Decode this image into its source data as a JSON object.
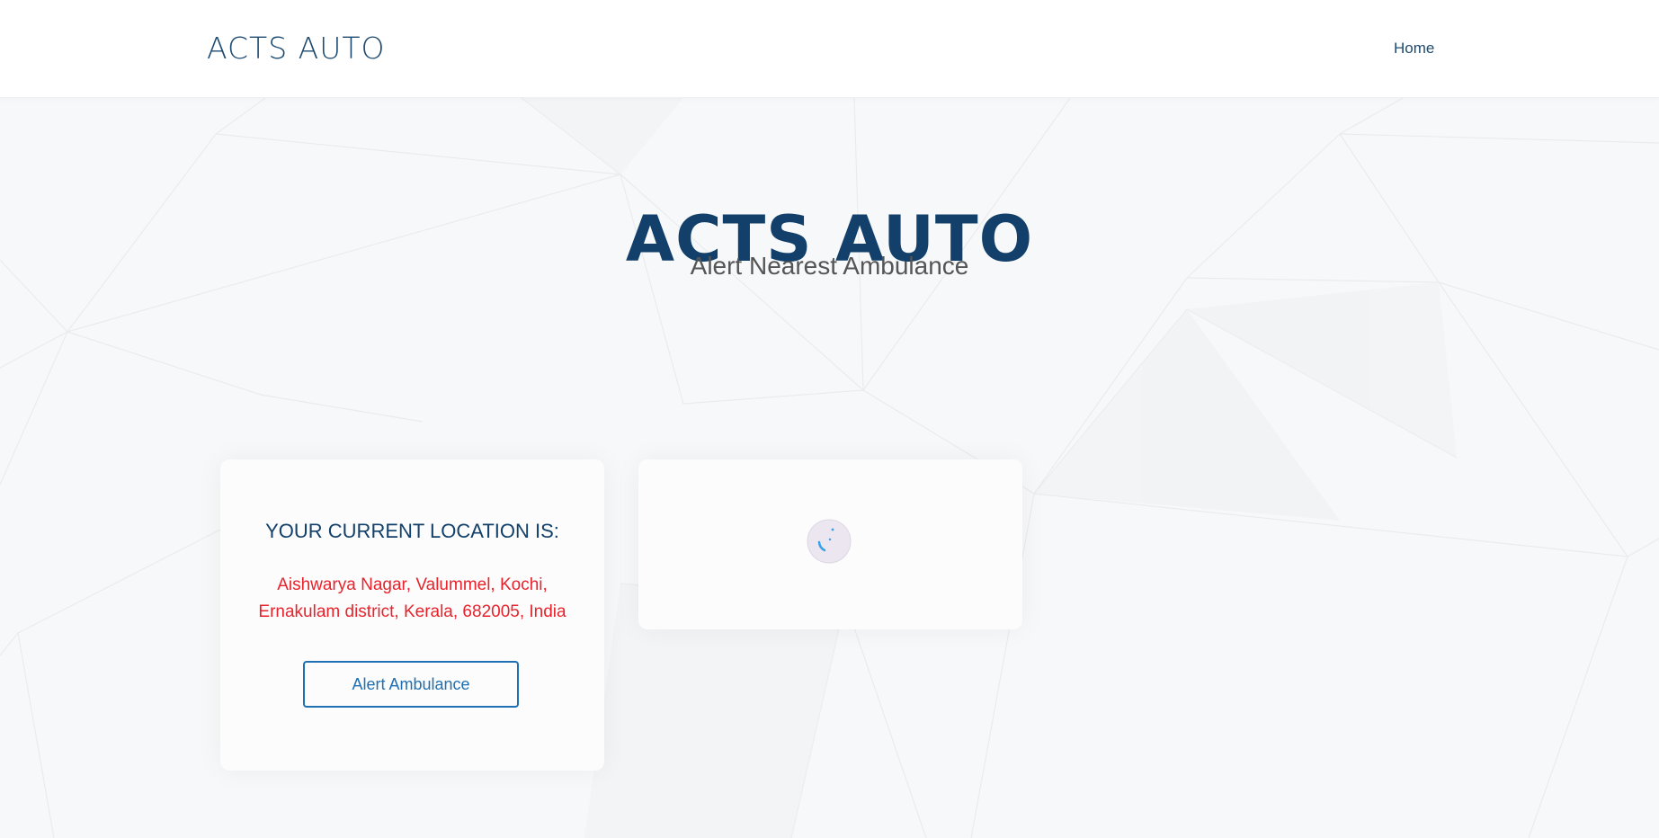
{
  "header": {
    "logo": "ACTS AUTO",
    "nav": {
      "home_label": "Home"
    }
  },
  "hero": {
    "title": "ACTS AUTO",
    "subtitle": "Alert Nearest Ambulance"
  },
  "location_card": {
    "heading": "YOUR CURRENT LOCATION IS:",
    "address": "Aishwarya Nagar, Valummel, Kochi, Ernakulam district, Kerala, 682005, India",
    "button_label": "Alert Ambulance"
  },
  "map_card": {
    "loading_icon": "spinner-icon"
  },
  "colors": {
    "brand": "#12406a",
    "address": "#e8232c",
    "button": "#1e6fb3",
    "spinner": "#3aa0e8"
  }
}
